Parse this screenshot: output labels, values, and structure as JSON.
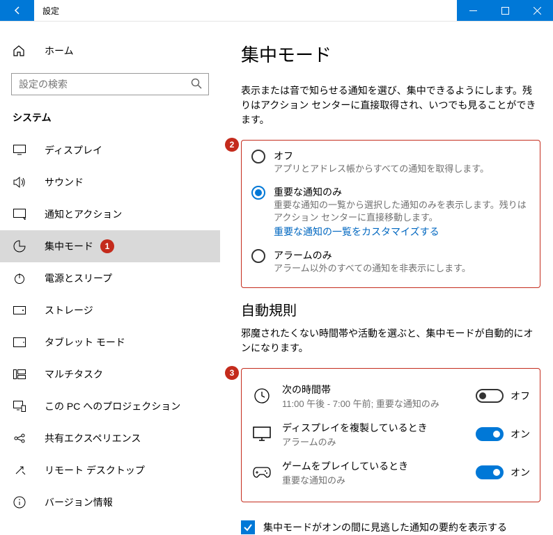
{
  "window": {
    "title": "設定"
  },
  "sidebar": {
    "home": "ホーム",
    "search_placeholder": "設定の検索",
    "section": "システム",
    "items": [
      {
        "label": "ディスプレイ"
      },
      {
        "label": "サウンド"
      },
      {
        "label": "通知とアクション"
      },
      {
        "label": "集中モード",
        "badge": "1"
      },
      {
        "label": "電源とスリープ"
      },
      {
        "label": "ストレージ"
      },
      {
        "label": "タブレット モード"
      },
      {
        "label": "マルチタスク"
      },
      {
        "label": "この PC へのプロジェクション"
      },
      {
        "label": "共有エクスペリエンス"
      },
      {
        "label": "リモート デスクトップ"
      },
      {
        "label": "バージョン情報"
      }
    ]
  },
  "page": {
    "title": "集中モード",
    "desc": "表示または音で知らせる通知を選び、集中できるようにします。残りはアクション センターに直接取得され、いつでも見ることができます。",
    "box2_badge": "2",
    "radios": {
      "off_label": "オフ",
      "off_sub": "アプリとアドレス帳からすべての通知を取得します。",
      "imp_label": "重要な通知のみ",
      "imp_sub": "重要な通知の一覧から選択した通知のみを表示します。残りはアクション センターに直接移動します。",
      "imp_link": "重要な通知の一覧をカスタマイズする",
      "alarm_label": "アラームのみ",
      "alarm_sub": "アラーム以外のすべての通知を非表示にします。"
    },
    "auto_heading": "自動規則",
    "auto_desc": "邪魔されたくない時間帯や活動を選ぶと、集中モードが自動的にオンになります。",
    "box3_badge": "3",
    "rules": {
      "time_label": "次の時間帯",
      "time_sub": "11:00 午後 - 7:00 午前; 重要な通知のみ",
      "time_state": "オフ",
      "dup_label": "ディスプレイを複製しているとき",
      "dup_sub": "アラームのみ",
      "dup_state": "オン",
      "game_label": "ゲームをプレイしているとき",
      "game_sub": "重要な通知のみ",
      "game_state": "オン"
    },
    "summary_check": "集中モードがオンの間に見逃した通知の要約を表示する"
  }
}
